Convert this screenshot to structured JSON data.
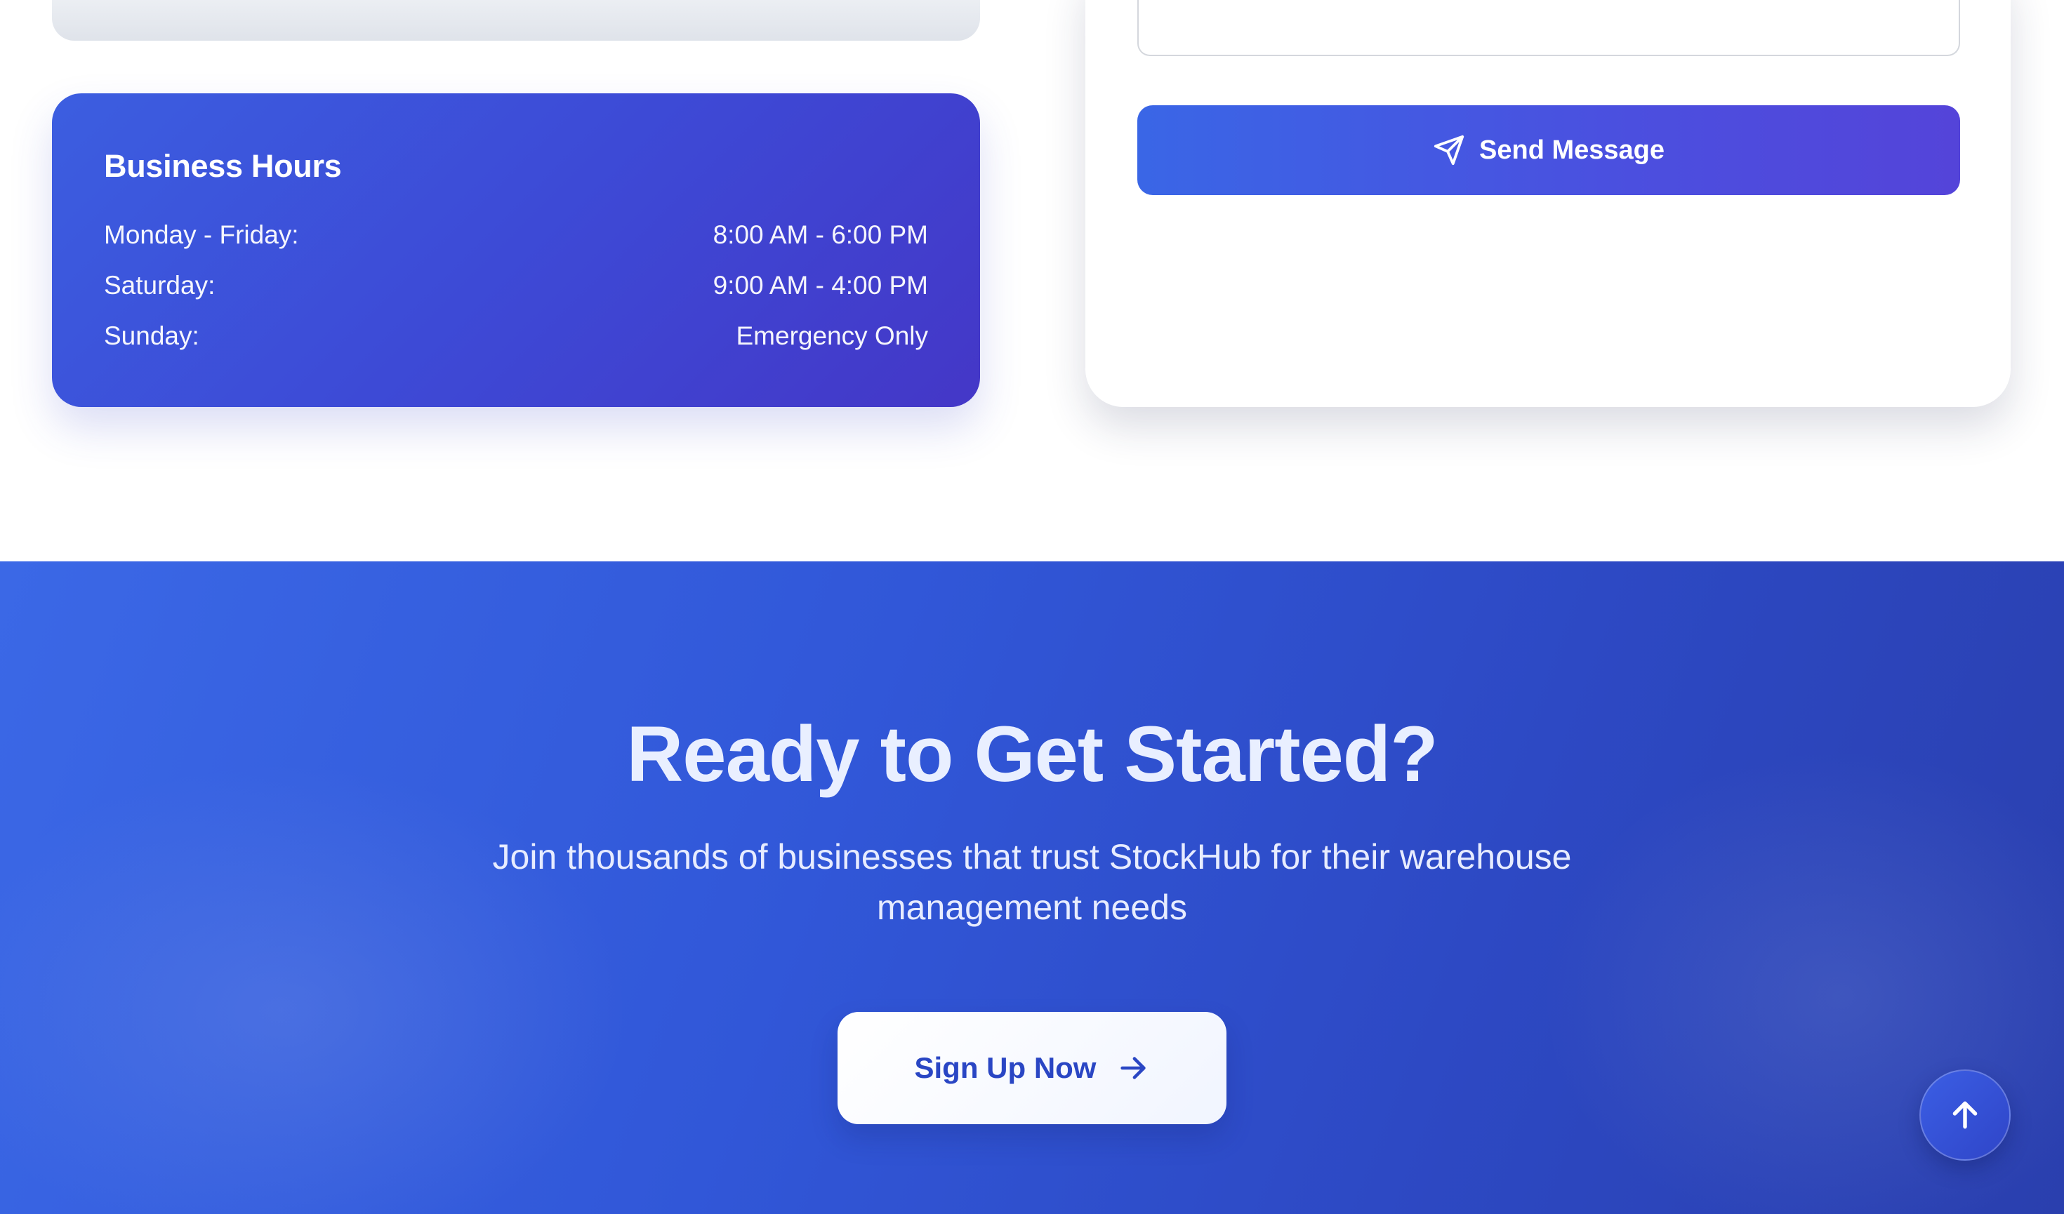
{
  "business_hours": {
    "title": "Business Hours",
    "rows": [
      {
        "day": "Monday - Friday:",
        "time": "8:00 AM - 6:00 PM"
      },
      {
        "day": "Saturday:",
        "time": "9:00 AM - 4:00 PM"
      },
      {
        "day": "Sunday:",
        "time": "Emergency Only"
      }
    ]
  },
  "contact_form": {
    "send_label": "Send Message",
    "send_icon": "paper-plane-icon"
  },
  "cta": {
    "title": "Ready to Get Started?",
    "subtitle": "Join thousands of businesses that trust StockHub for their warehouse management needs",
    "button_label": "Sign Up Now",
    "button_icon": "arrow-right-icon"
  },
  "scroll_top": {
    "icon": "arrow-up-icon"
  },
  "colors": {
    "hours_card": "#3d4ad6",
    "send_button": "#4b4fdf",
    "cta_background": "#3157d8",
    "signup_text": "#2a46c4"
  }
}
